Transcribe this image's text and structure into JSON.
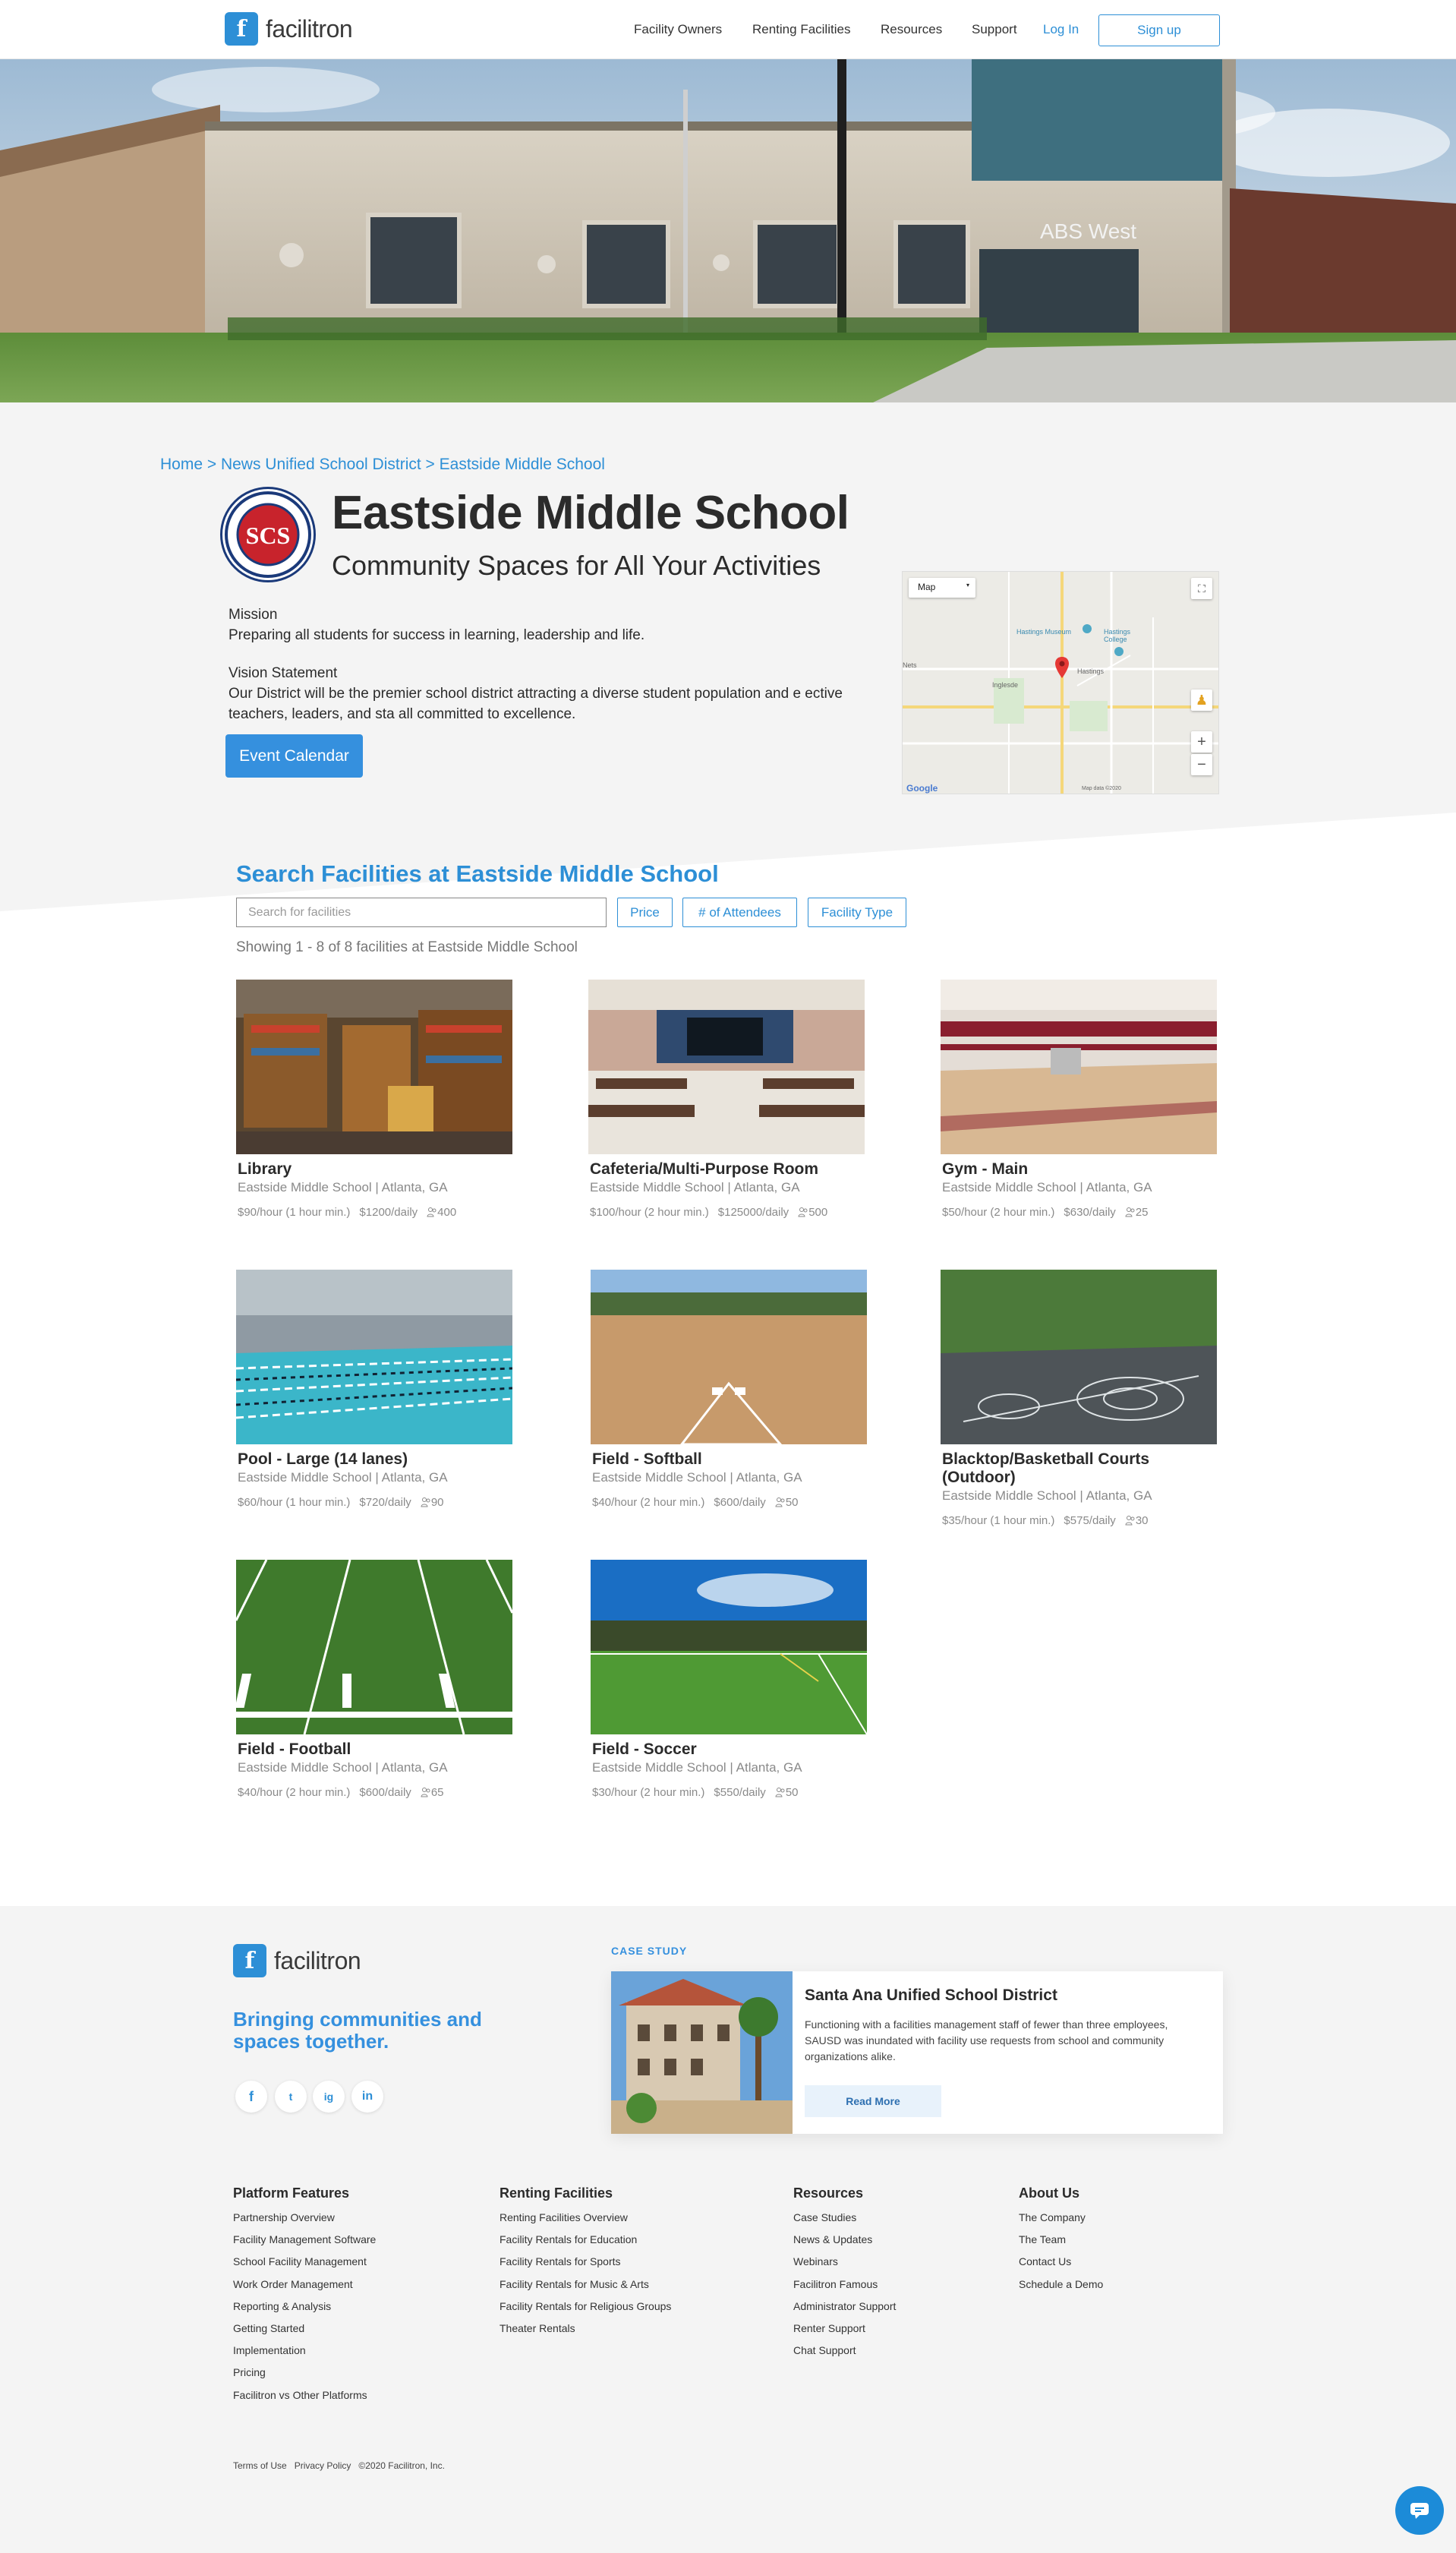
{
  "header": {
    "logo_text": "facilitron",
    "nav": [
      "Facility Owners",
      "Renting Facilities",
      "Resources",
      "Support"
    ],
    "login": "Log In",
    "signup": "Sign up"
  },
  "hero": {
    "building_sign": "ABS West"
  },
  "breadcrumb": "Home > News Unified School District > Eastside Middle School",
  "school": {
    "seal_text": "SCS",
    "name": "Eastside Middle School",
    "subtitle": "Community Spaces for All Your Activities",
    "mission_label": "Mission",
    "mission": "Preparing all students for success in learning, leadership and life.",
    "vision_label": "Vision Statement",
    "vision": "Our District will be the premier school district attracting a diverse student population and e ective teachers, leaders, and sta all committed to excellence.",
    "event_button": "Event Calendar"
  },
  "map": {
    "type_select": "Map",
    "labels": [
      "Hastings Museum",
      "Hastings College",
      "Inglesde",
      "Hastings",
      "Nets"
    ],
    "zoom_in": "+",
    "zoom_out": "−",
    "attribution": "Map data ©2020",
    "google": "Google"
  },
  "search": {
    "title": "Search Facilities at Eastside Middle School",
    "placeholder": "Search for facilities",
    "filters": [
      "Price",
      "# of Attendees",
      "Facility Type"
    ],
    "showing": "Showing 1 - 8 of 8 facilities at Eastside Middle School"
  },
  "facilities": [
    {
      "name": "Library",
      "location": "Eastside Middle School | Atlanta, GA",
      "hourly": "$90/hour (1 hour min.)",
      "daily": "$1200/daily",
      "capacity": "400"
    },
    {
      "name": "Cafeteria/Multi-Purpose Room",
      "location": "Eastside Middle School | Atlanta, GA",
      "hourly": "$100/hour (2 hour min.)",
      "daily": "$125000/daily",
      "capacity": "500"
    },
    {
      "name": "Gym - Main",
      "location": "Eastside Middle School | Atlanta, GA",
      "hourly": "$50/hour (2 hour min.)",
      "daily": "$630/daily",
      "capacity": "25"
    },
    {
      "name": "Pool - Large (14 lanes)",
      "location": "Eastside Middle School | Atlanta, GA",
      "hourly": "$60/hour (1 hour min.)",
      "daily": "$720/daily",
      "capacity": "90"
    },
    {
      "name": "Field - Softball",
      "location": "Eastside Middle School | Atlanta, GA",
      "hourly": "$40/hour (2 hour min.)",
      "daily": "$600/daily",
      "capacity": "50"
    },
    {
      "name": "Blacktop/Basketball Courts (Outdoor)",
      "location": "Eastside Middle School | Atlanta, GA",
      "hourly": "$35/hour (1 hour min.)",
      "daily": "$575/daily",
      "capacity": "30"
    },
    {
      "name": "Field - Football",
      "location": "Eastside Middle School | Atlanta, GA",
      "hourly": "$40/hour (2 hour min.)",
      "daily": "$600/daily",
      "capacity": "65"
    },
    {
      "name": "Field - Soccer",
      "location": "Eastside Middle School | Atlanta, GA",
      "hourly": "$30/hour (2 hour min.)",
      "daily": "$550/daily",
      "capacity": "50"
    }
  ],
  "footer": {
    "logo_text": "facilitron",
    "tagline": "Bringing communities and spaces together.",
    "social": [
      "f",
      "t",
      "ig",
      "in"
    ],
    "case_study": {
      "label": "CASE STUDY",
      "title": "Santa Ana Unified School District",
      "body": "Functioning with a facilities management staff of fewer than three employees, SAUSD was inundated with facility use requests from school and community organizations alike.",
      "button": "Read More"
    },
    "columns": [
      {
        "title": "Platform Features",
        "items": [
          "Partnership Overview",
          "Facility Management Software",
          "School Facility Management",
          "Work Order Management",
          "Reporting & Analysis",
          "Getting Started",
          "Implementation",
          "Pricing",
          "Facilitron vs Other Platforms"
        ]
      },
      {
        "title": "Renting Facilities",
        "items": [
          "Renting Facilities Overview",
          "Facility Rentals for Education",
          "Facility Rentals for Sports",
          "Facility Rentals for Music & Arts",
          "Facility Rentals for Religious Groups",
          "Theater Rentals"
        ]
      },
      {
        "title": "Resources",
        "items": [
          "Case Studies",
          "News & Updates",
          "Webinars",
          "Facilitron Famous",
          "Administrator Support",
          "Renter Support",
          "Chat Support"
        ]
      },
      {
        "title": "About Us",
        "items": [
          "The Company",
          "The Team",
          "Contact Us",
          "Schedule a Demo"
        ]
      }
    ],
    "legal": [
      "Terms of Use",
      "Privacy Policy",
      "©2020 Facilitron, Inc."
    ]
  },
  "colors": {
    "accent": "#2d8fd6",
    "button": "#3590de",
    "section_bg": "#f4f4f4"
  }
}
